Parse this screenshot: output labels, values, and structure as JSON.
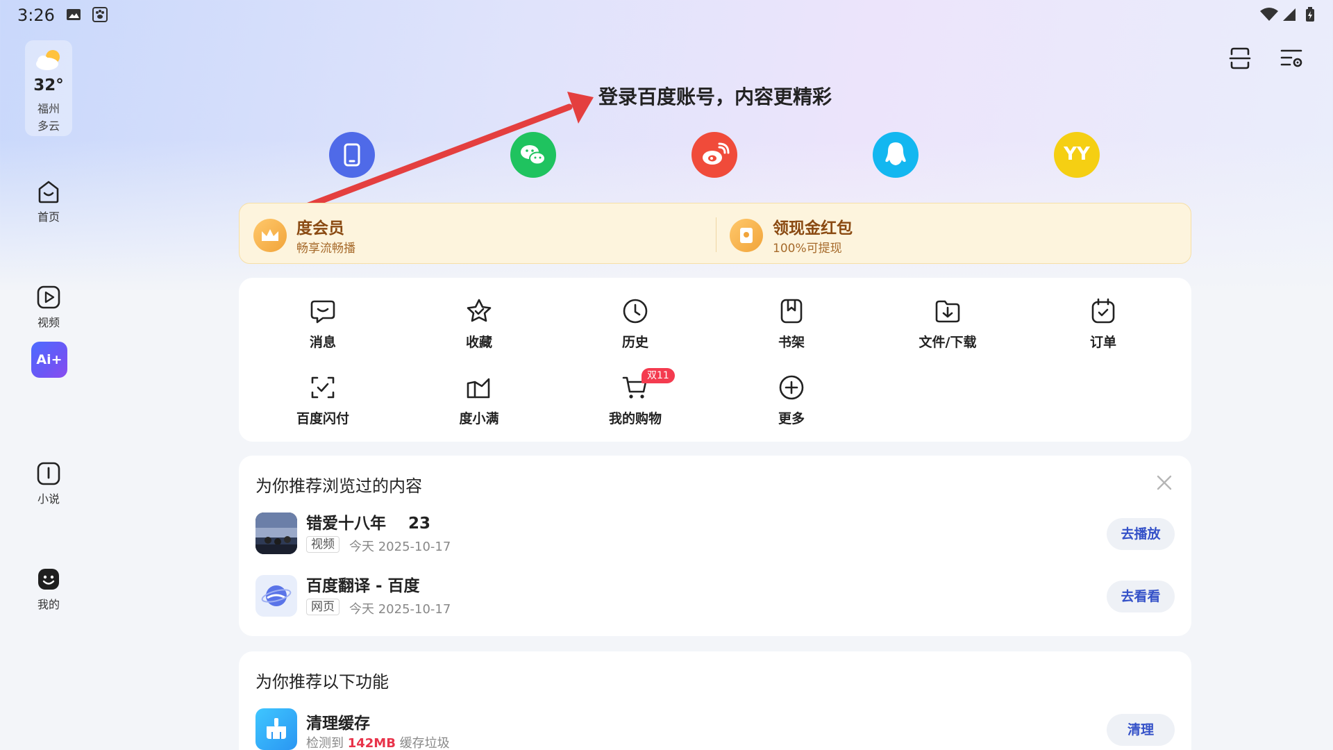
{
  "status_bar": {
    "time": "3:26"
  },
  "weather": {
    "temp": "32°",
    "city": "福州",
    "condition": "多云"
  },
  "sidebar": {
    "items": [
      {
        "label": "首页"
      },
      {
        "label": "视频"
      },
      {
        "label": "Ai+"
      },
      {
        "label": "小说"
      },
      {
        "label": "我的"
      }
    ]
  },
  "login": {
    "title": "登录百度账号，内容更精彩",
    "yy_text": "YY"
  },
  "banner": {
    "vip_title": "度会员",
    "vip_sub": "畅享流畅播",
    "redpacket_title": "领现金红包",
    "redpacket_sub": "100%可提现"
  },
  "quick_grid": {
    "items": [
      {
        "label": "消息"
      },
      {
        "label": "收藏"
      },
      {
        "label": "历史"
      },
      {
        "label": "书架"
      },
      {
        "label": "文件/下载"
      },
      {
        "label": "订单"
      },
      {
        "label": "百度闪付"
      },
      {
        "label": "度小满"
      },
      {
        "label": "我的购物"
      },
      {
        "label": "更多"
      }
    ],
    "shopping_badge": "双11"
  },
  "recent": {
    "title": "为你推荐浏览过的内容",
    "items": [
      {
        "title": "错爱十八年    23",
        "tag": "视频",
        "meta": "今天  2025-10-17",
        "button": "去播放"
      },
      {
        "title": "百度翻译 - 百度",
        "tag": "网页",
        "meta": "今天  2025-10-17",
        "button": "去看看"
      }
    ]
  },
  "features": {
    "title": "为你推荐以下功能",
    "item": {
      "title": "清理缓存",
      "sub_prefix": "检测到 ",
      "sub_value": "142MB",
      "sub_suffix": " 缓存垃圾",
      "button": "清理"
    }
  },
  "colors": {
    "accent": "#3451c8",
    "phone": "#4f6ae8",
    "wechat": "#1fc35f",
    "weibo": "#f04b3a",
    "qq": "#13b7f0",
    "yy": "#f5cf13",
    "arrow": "#e43f3f"
  }
}
